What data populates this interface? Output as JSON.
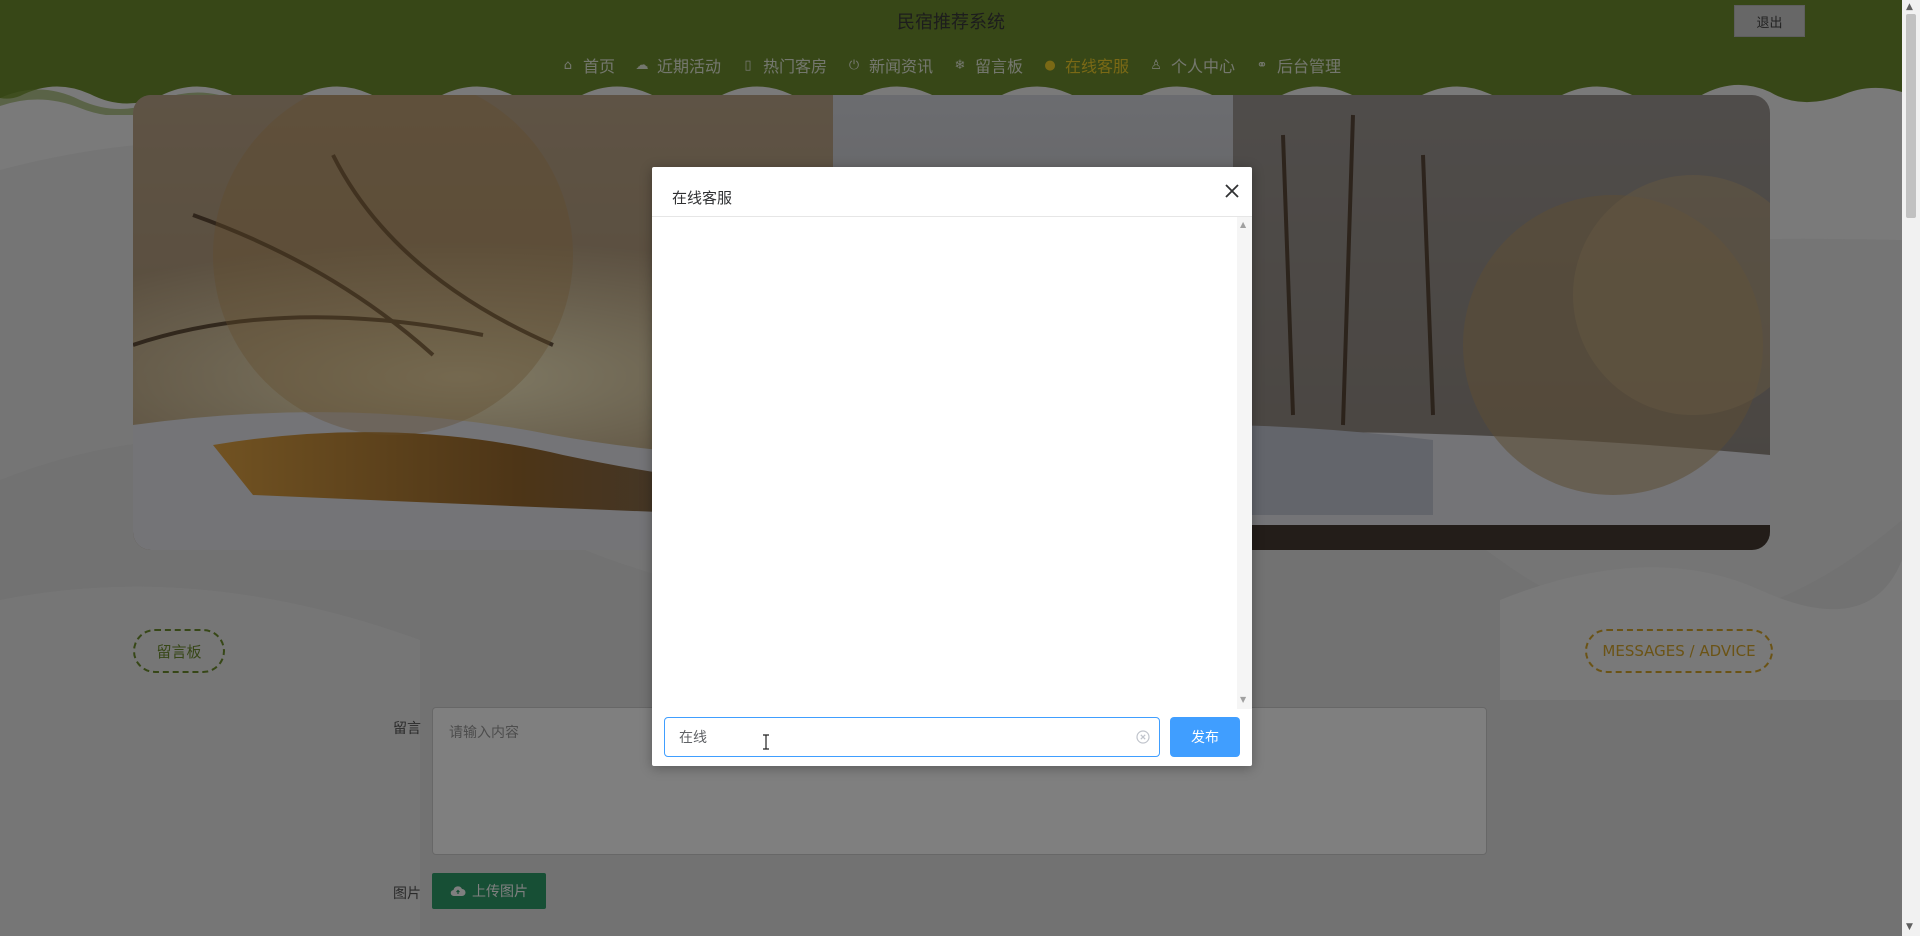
{
  "header": {
    "site_title": "民宿推荐系统",
    "logout_label": "退出",
    "nav": [
      {
        "label": "首页",
        "icon": "home-icon"
      },
      {
        "label": "近期活动",
        "icon": "palette-icon"
      },
      {
        "label": "热门客房",
        "icon": "bookmark-icon"
      },
      {
        "label": "新闻资讯",
        "icon": "power-icon"
      },
      {
        "label": "留言板",
        "icon": "snowflake-icon"
      },
      {
        "label": "在线客服",
        "icon": "chat-icon",
        "active": true
      },
      {
        "label": "个人中心",
        "icon": "user-icon"
      },
      {
        "label": "后台管理",
        "icon": "link-icon"
      }
    ]
  },
  "section": {
    "title_left": "留言板",
    "title_right": "MESSAGES / ADVICE"
  },
  "form": {
    "message_label": "留言",
    "message_placeholder": "请输入内容",
    "image_label": "图片",
    "upload_label": "上传图片"
  },
  "dialog": {
    "title": "在线客服",
    "input_value": "在线",
    "publish_label": "发布"
  },
  "colors": {
    "header_green": "#6e8f2e",
    "active_nav": "#f5d22b",
    "primary_blue": "#409eff",
    "upload_green": "#2f9e6b"
  }
}
